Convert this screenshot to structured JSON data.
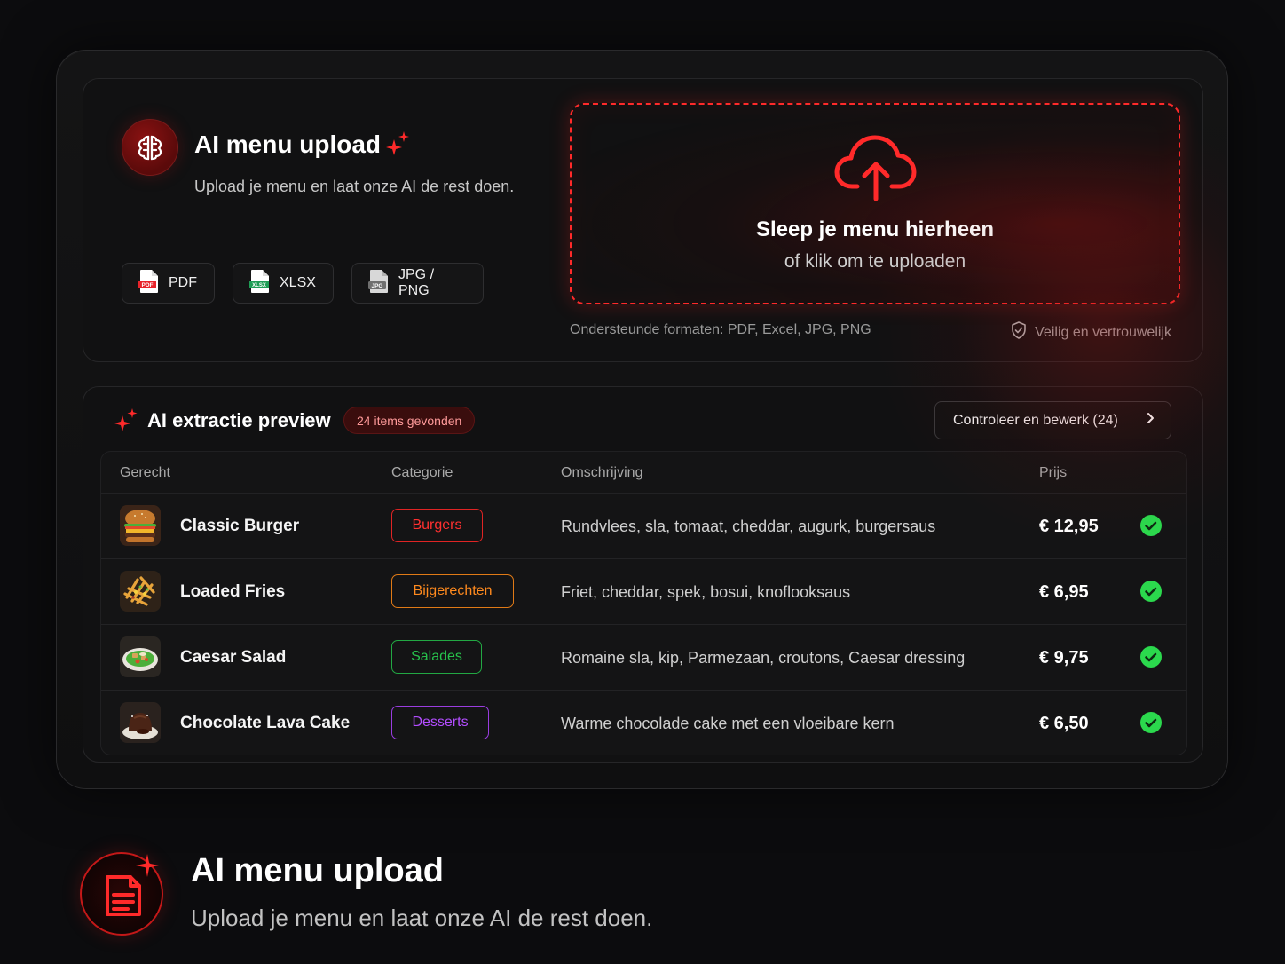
{
  "upload": {
    "title": "AI menu upload",
    "subtitle": "Upload je menu en laat onze AI de rest doen.",
    "chips": [
      {
        "label": "PDF",
        "icon": "pdf-file-icon",
        "color": "#e8232a"
      },
      {
        "label": "XLSX",
        "icon": "xlsx-file-icon",
        "color": "#1f9d55"
      },
      {
        "label": "JPG / PNG",
        "icon": "jpg-file-icon",
        "color": "#8a8a8a"
      }
    ],
    "dropzone": {
      "title": "Sleep je menu hierheen",
      "subtitle": "of klik om te uploaden"
    },
    "formats": "Ondersteunde formaten: PDF, Excel, JPG, PNG",
    "secure": "Veilig en vertrouwelijk"
  },
  "preview": {
    "title": "AI extractie preview",
    "badge": "24 items gevonden",
    "review_button": "Controleer en bewerk (24)",
    "columns": [
      "Gerecht",
      "Categorie",
      "Omschrijving",
      "Prijs"
    ],
    "rows": [
      {
        "dish": "Classic Burger",
        "category": "Burgers",
        "category_color": "#ff3030",
        "description": "Rundvlees, sla, tomaat, cheddar, augurk, burgersaus",
        "price": "€ 12,95",
        "thumb": "burger-image"
      },
      {
        "dish": "Loaded Fries",
        "category": "Bijgerechten",
        "category_color": "#ff8a1e",
        "description": "Friet, cheddar, spek, bosui, knoflooksaus",
        "price": "€ 6,95",
        "thumb": "fries-image"
      },
      {
        "dish": "Caesar Salad",
        "category": "Salades",
        "category_color": "#27c24c",
        "description": "Romaine sla, kip, Parmezaan, croutons, Caesar dressing",
        "price": "€ 9,75",
        "thumb": "salad-image"
      },
      {
        "dish": "Chocolate Lava Cake",
        "category": "Desserts",
        "category_color": "#b34dff",
        "description": "Warme chocolade cake met een vloeibare kern",
        "price": "€ 6,50",
        "thumb": "cake-image"
      }
    ]
  },
  "footer": {
    "title": "AI menu upload",
    "subtitle": "Upload je menu en laat onze AI de rest doen."
  },
  "colors": {
    "accent": "#ff2a2a",
    "success": "#2bd94d",
    "background": "#0c0c0e"
  }
}
